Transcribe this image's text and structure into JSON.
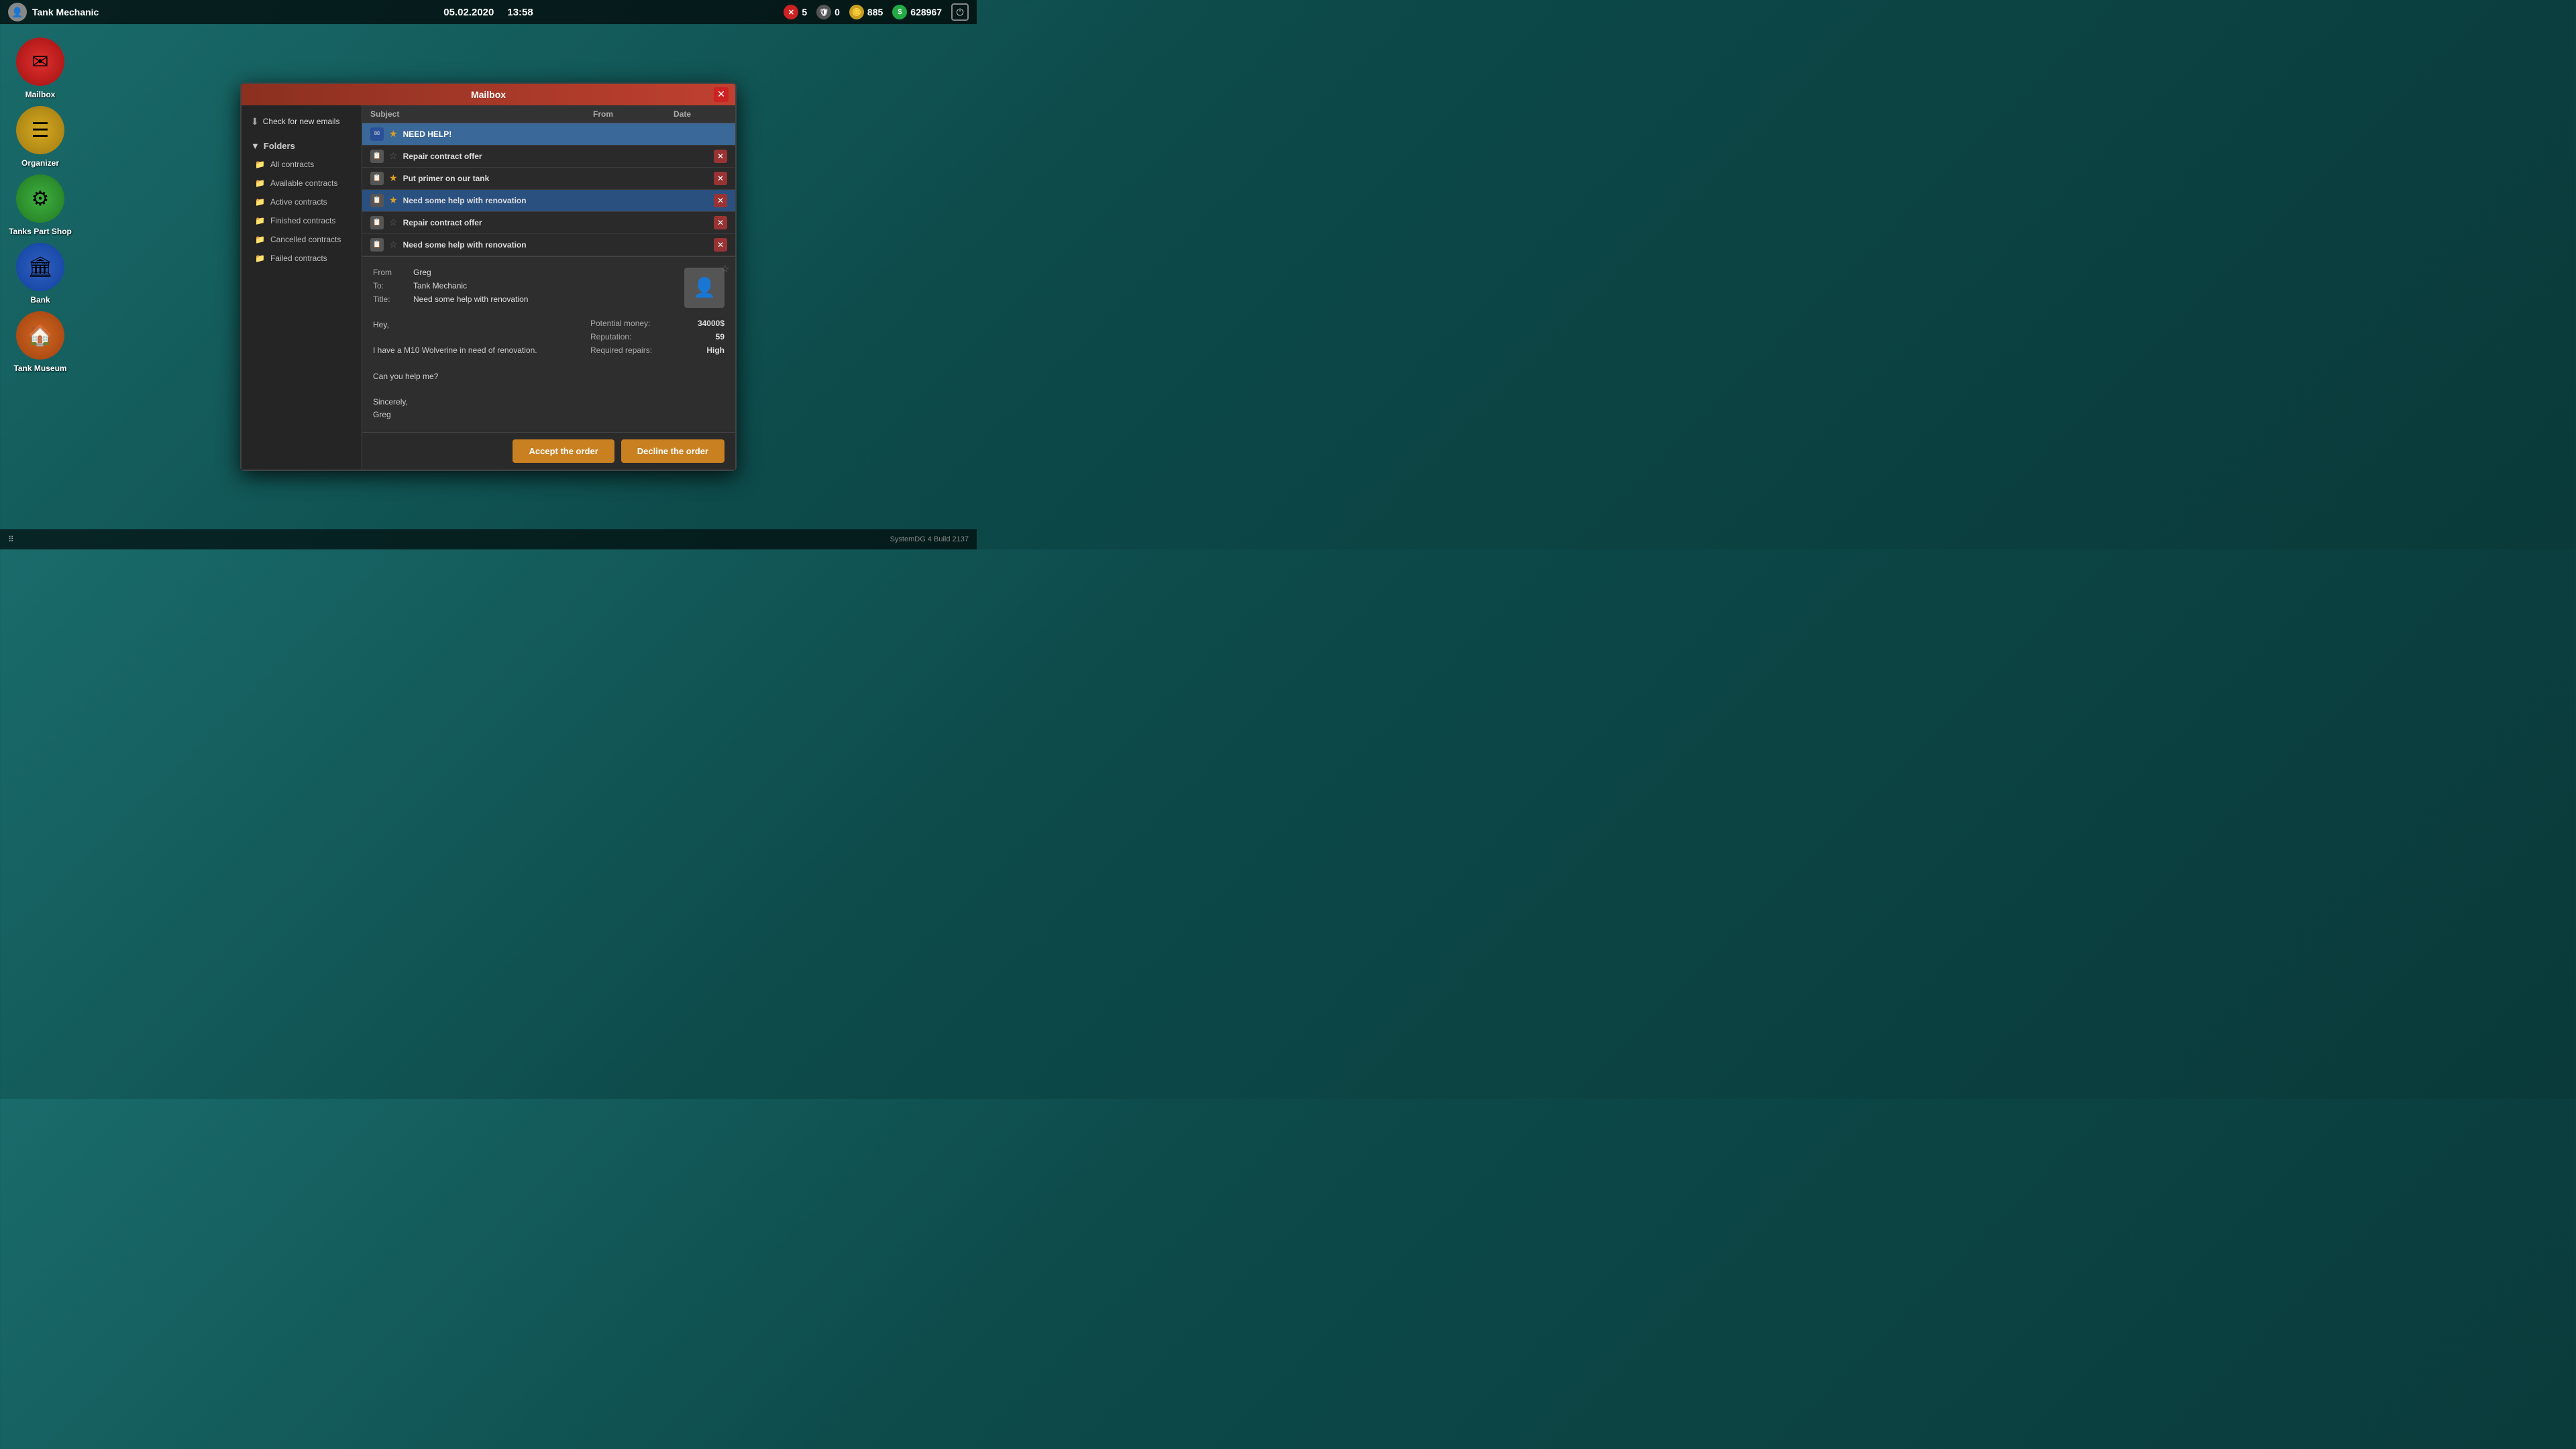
{
  "topbar": {
    "player_name": "Tank Mechanic",
    "date": "05.02.2020",
    "time": "13:58",
    "errors": "5",
    "zero_count": "0",
    "coins": "885",
    "money": "628967",
    "power_icon": "⏻"
  },
  "sidebar": {
    "items": [
      {
        "id": "mailbox",
        "label": "Mailbox",
        "icon": "✉",
        "color": "red"
      },
      {
        "id": "organizer",
        "label": "Organizer",
        "icon": "☰",
        "color": "yellow"
      },
      {
        "id": "tanks-part-shop",
        "label": "Tanks Part Shop",
        "icon": "⚙",
        "color": "green"
      },
      {
        "id": "bank",
        "label": "Bank",
        "icon": "🏛",
        "color": "blue"
      },
      {
        "id": "tank-museum",
        "label": "Tank Museum",
        "icon": "🏠",
        "color": "orange"
      }
    ]
  },
  "bottombar": {
    "version": "SystemDG 4",
    "build": "Build 2137"
  },
  "modal": {
    "title": "Mailbox",
    "check_emails_label": "Check for new emails",
    "folders": {
      "label": "Folders",
      "items": [
        {
          "id": "all-contracts",
          "label": "All contracts"
        },
        {
          "id": "available-contracts",
          "label": "Available contracts"
        },
        {
          "id": "active-contracts",
          "label": "Active contracts"
        },
        {
          "id": "finished-contracts",
          "label": "Finished contracts"
        },
        {
          "id": "cancelled-contracts",
          "label": "Cancelled contracts"
        },
        {
          "id": "failed-contracts",
          "label": "Failed contracts"
        }
      ]
    },
    "email_list": {
      "columns": {
        "subject": "Subject",
        "from": "From",
        "date": "Date"
      },
      "emails": [
        {
          "id": 1,
          "subject": "NEED HELP!",
          "starred": true,
          "selected": true,
          "icon_type": "blue-bg"
        },
        {
          "id": 2,
          "subject": "Repair contract offer",
          "starred": false,
          "selected": false,
          "icon_type": "normal",
          "has_delete": true
        },
        {
          "id": 3,
          "subject": "Put primer on our tank",
          "starred": true,
          "selected": false,
          "icon_type": "normal",
          "has_delete": true
        },
        {
          "id": 4,
          "subject": "Need some help with renovation",
          "starred": true,
          "selected": true,
          "icon_type": "normal",
          "has_delete": true,
          "highlighted": true
        },
        {
          "id": 5,
          "subject": "Repair contract offer",
          "starred": false,
          "selected": false,
          "icon_type": "normal",
          "has_delete": true
        },
        {
          "id": 6,
          "subject": "Need some help with renovation",
          "starred": false,
          "selected": false,
          "icon_type": "normal",
          "has_delete": true
        }
      ]
    },
    "email_content": {
      "from_label": "From",
      "from_value": "Greg",
      "to_label": "To:",
      "to_value": "Tank Mechanic",
      "title_label": "Title:",
      "title_value": "Need some help with renovation",
      "body_greeting": "Hey,",
      "body_line1": "I have a M10 Wolverine in need of renovation.",
      "body_line2": "Can you help me?",
      "body_closing": "Sincerely,",
      "body_signature": "Greg",
      "stats": {
        "potential_money_label": "Potential money:",
        "potential_money_value": "34000$",
        "reputation_label": "Reputation:",
        "reputation_value": "59",
        "required_repairs_label": "Required repairs:",
        "required_repairs_value": "High"
      }
    },
    "actions": {
      "accept_label": "Accept the order",
      "decline_label": "Decline the order"
    }
  }
}
